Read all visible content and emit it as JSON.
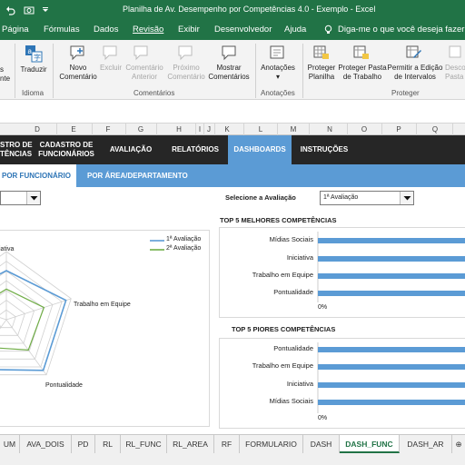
{
  "window": {
    "title": "Planilha de Av. Desempenho por Competências 4.0 - Exemplo  -  Excel"
  },
  "menu": {
    "tabs": [
      "Página",
      "Fórmulas",
      "Dados",
      "Revisão",
      "Exibir",
      "Desenvolvedor",
      "Ajuda"
    ],
    "active": "Revisão",
    "tell_me": "Diga-me o que você deseja fazer"
  },
  "ribbon": {
    "left_partial": [
      "s",
      "nte"
    ],
    "translate": "Traduzir",
    "new_comment": [
      "Novo",
      "Comentário"
    ],
    "delete": "Excluir",
    "prev_comment": [
      "Comentário",
      "Anterior"
    ],
    "next_comment": [
      "Próximo",
      "Comentário"
    ],
    "show_comments": [
      "Mostrar",
      "Comentários"
    ],
    "notes": "Anotações",
    "protect_sheet": [
      "Proteger",
      "Planilha"
    ],
    "protect_workbook": [
      "Proteger Pasta",
      "de Trabalho"
    ],
    "allow_edit": [
      "Permitir a Edição",
      "de Intervalos"
    ],
    "unshare": [
      "Desco",
      "Pasta d"
    ],
    "groups": {
      "language": "Idioma",
      "comments": "Comentários",
      "notes": "Anotações",
      "protect": "Proteger"
    }
  },
  "columns": [
    "D",
    "E",
    "F",
    "G",
    "H",
    "I",
    "J",
    "K",
    "L",
    "M",
    "N",
    "O",
    "P",
    "Q"
  ],
  "nav": {
    "items": [
      [
        "STRO DE",
        "TÊNCIAS"
      ],
      [
        "CADASTRO DE",
        "FUNCIONÁRIOS"
      ],
      [
        "AVALIAÇÃO"
      ],
      [
        "RELATÓRIOS"
      ],
      [
        "DASHBOARDS"
      ],
      [
        "INSTRUÇÕES"
      ]
    ],
    "active_index": 4
  },
  "subnav": {
    "by_employee": "POR FUNCIONÁRIO",
    "by_area": "POR ÁREA/DEPARTAMENTO"
  },
  "dashboard": {
    "select_eval_label": "Selecione a Avaliação",
    "select_eval_value": "1ª Avaliação",
    "best_title": "TOP 5 MELHORES COMPETÊNCIAS",
    "worst_title": "TOP 5 PIORES COMPETÊNCIAS",
    "radar_labels": [
      "iativa",
      "Trabalho em Equipe",
      "Pontualidade"
    ],
    "colors": {
      "series1": "#5b9bd5",
      "series2": "#70ad47"
    }
  },
  "chart_data": [
    {
      "type": "radar",
      "series": [
        {
          "name": "1ª Avaliação"
        },
        {
          "name": "2ª Avaliação"
        }
      ]
    },
    {
      "type": "bar",
      "title": "TOP 5 MELHORES COMPETÊNCIAS",
      "categories": [
        "Mídias Sociais",
        "Iniciativa",
        "Trabalho em Equipe",
        "Pontualidade"
      ],
      "x_tick_first": "0%"
    },
    {
      "type": "bar",
      "title": "TOP 5 PIORES COMPETÊNCIAS",
      "categories": [
        "Pontualidade",
        "Trabalho em Equipe",
        "Iniciativa",
        "Mídias Sociais"
      ],
      "x_tick_first": "0%"
    }
  ],
  "sheets": {
    "tabs": [
      "UM",
      "AVA_DOIS",
      "PD",
      "RL",
      "RL_FUNC",
      "RL_AREA",
      "RF",
      "FORMULARIO",
      "DASH",
      "DASH_FUNC",
      "DASH_AR"
    ],
    "active": "DASH_FUNC"
  }
}
